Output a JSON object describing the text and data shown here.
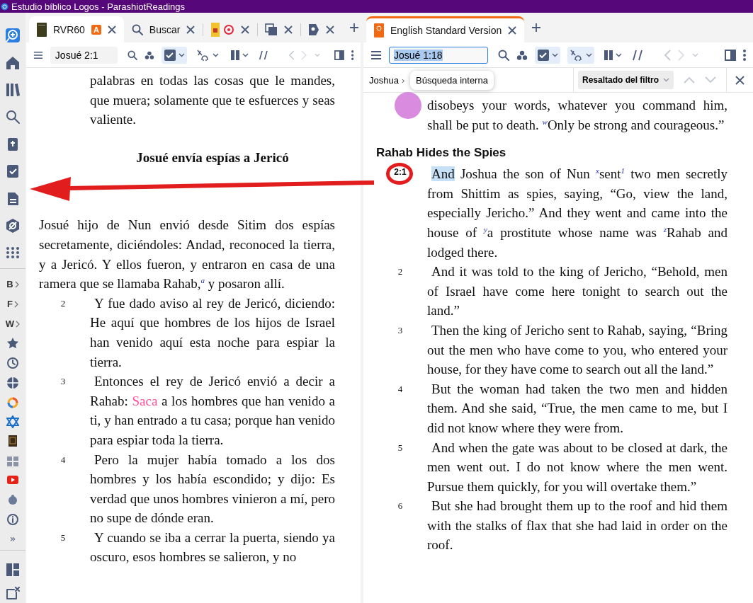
{
  "window": {
    "title": "Estudio bíblico Logos - ParashiotReadings"
  },
  "sidebar": {
    "letters": [
      {
        "label": "B"
      },
      {
        "label": "F"
      },
      {
        "label": "W"
      }
    ],
    "more": "»"
  },
  "panes": [
    {
      "active": false,
      "tabs": [
        {
          "kind": "resource",
          "label": "RVR60",
          "badge": "A",
          "selected": true
        },
        {
          "kind": "search",
          "label": "Buscar",
          "selected": false
        },
        {
          "kind": "resource-icons",
          "selected": false
        },
        {
          "kind": "copies",
          "selected": false
        },
        {
          "kind": "tag",
          "selected": false
        }
      ],
      "toolbar": {
        "reference": "Josué 2:1",
        "focused": false,
        "visual_filters_on": true,
        "interlinear_on": false
      },
      "blocks": [
        {
          "kind": "continuation",
          "text": "palabras en todas las cosas que le mandes, que muera; solamente que te esfuerces y seas valiente."
        },
        {
          "kind": "heading",
          "text": "Josué envía espías a Jericó"
        },
        {
          "kind": "chapter-start",
          "text": "Josué hijo de Nun envió desde Sitim dos espías secretamente, diciéndoles: Andad, reconoced la tierra, y a Jericó. Y ellos fueron, y entraron en casa de una ramera que se llamaba Rahab,$^{a}$ y posaron allí."
        },
        {
          "kind": "verse",
          "number": "2",
          "text": "Y fue dado aviso al rey de Jericó, diciendo: He aquí que hombres de los hijos de Israel han venido aquí esta noche para espiar la tierra."
        },
        {
          "kind": "verse",
          "number": "3",
          "parts": [
            {
              "kind": "plain",
              "text": "Entonces el rey de Jericó envió a decir a Rahab: "
            },
            {
              "kind": "search-hit",
              "text": "Saca"
            },
            {
              "kind": "plain",
              "text": " a los hombres que han venido a ti, y han entrado a tu casa; porque han venido para espiar toda la tierra."
            }
          ]
        },
        {
          "kind": "verse",
          "number": "4",
          "text": "Pero la mujer había tomado a los dos hombres y los había escondido; y dijo: Es verdad que unos hombres vinieron a mí, pero no supe de dónde eran."
        },
        {
          "kind": "verse",
          "number": "5",
          "text": "Y cuando se iba a cerrar la puerta, siendo ya oscuro, esos hombres se salieron, y no"
        }
      ]
    },
    {
      "active": true,
      "tabs": [
        {
          "kind": "resource",
          "label": "English Standard Version",
          "selected": true
        }
      ],
      "toolbar": {
        "reference": "Josué 1:18",
        "focused": true,
        "visual_filters_on": true,
        "interlinear_on": true
      },
      "find_bar": {
        "breadcrumb": "Joshua",
        "breadcrumb_separator": "›",
        "tooltip": "Búsqueda interna",
        "filter_button": "Resaltado del filtro"
      },
      "blocks": [
        {
          "kind": "continuation",
          "text": "disobeys your words, whatever you command him, shall be put to death. $^{w}$Only be strong and courageous.”"
        },
        {
          "kind": "heading",
          "text": "Rahab Hides the Spies"
        },
        {
          "kind": "verse",
          "number": "2:1",
          "circled": true,
          "parts": [
            {
              "kind": "selection",
              "text": "And"
            },
            {
              "kind": "plain",
              "text": " Joshua the son of Nun $^{x}$sent$^{1}$ two men secretly from Shittim as spies, saying, “Go, view the land, especially Jericho.” And they went and came into the house of $^{y}$a prostitute whose name was $^{z}$Rahab and lodged there."
            }
          ]
        },
        {
          "kind": "verse",
          "number": "2",
          "text": "And it was told to the king of Jericho, “Behold, men of Israel have come here tonight to search out the land.”"
        },
        {
          "kind": "verse",
          "number": "3",
          "text": "Then the king of Jericho sent to Rahab, saying, “Bring out the men who have come to you, who entered your house, for they have come to search out all the land.”"
        },
        {
          "kind": "verse",
          "number": "4",
          "text": "But the woman had taken the two men and hidden them. And she said, “True, the men came to me, but I did not know where they were from."
        },
        {
          "kind": "verse",
          "number": "5",
          "text": "And when the gate was about to be closed at dark, the men went out. I do not know where the men went. Pursue them quickly, for you will overtake them.”"
        },
        {
          "kind": "verse",
          "number": "6",
          "text": "But she had brought them up to the roof and hid them with the stalks of flax that she had laid in order on the roof."
        }
      ]
    }
  ]
}
